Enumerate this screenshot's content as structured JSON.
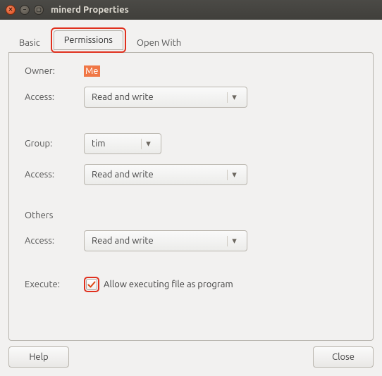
{
  "window": {
    "title": "minerd Properties"
  },
  "tabs": {
    "basic": "Basic",
    "permissions": "Permissions",
    "open_with": "Open With"
  },
  "labels": {
    "owner": "Owner:",
    "access": "Access:",
    "group": "Group:",
    "others": "Others",
    "execute": "Execute:"
  },
  "values": {
    "owner": "Me",
    "owner_access": "Read and write",
    "group": "tim",
    "group_access": "Read and write",
    "others_access": "Read and write",
    "execute_label": "Allow executing file as program",
    "execute_checked": true
  },
  "buttons": {
    "help": "Help",
    "close": "Close"
  }
}
